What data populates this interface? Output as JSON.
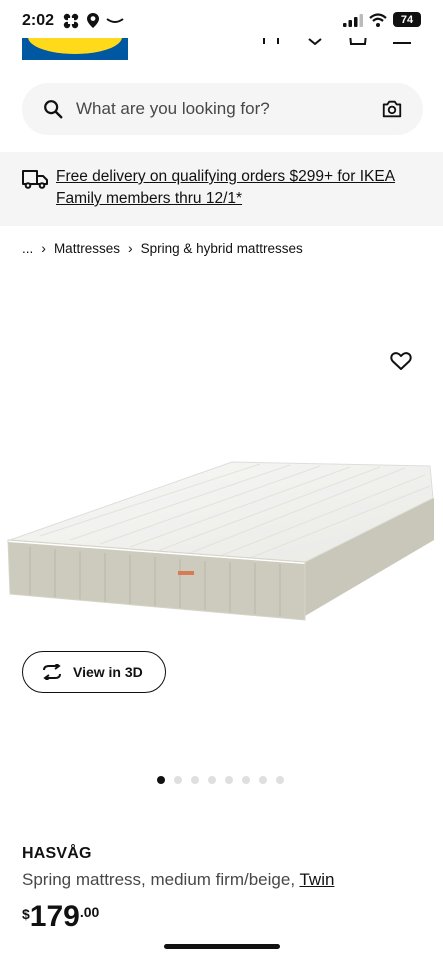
{
  "status_bar": {
    "time": "2:02",
    "battery": "74"
  },
  "search": {
    "placeholder": "What are you looking for?"
  },
  "promo": {
    "text": "Free delivery on qualifying orders $299+ for IKEA Family members thru 12/1*"
  },
  "breadcrumb": {
    "ellipsis": "...",
    "items": [
      "Mattresses",
      "Spring & hybrid mattresses"
    ]
  },
  "view3d": {
    "label": "View in 3D"
  },
  "gallery": {
    "dots": 8,
    "active_index": 0
  },
  "product": {
    "name": "HASVÅG",
    "description": "Spring mattress, medium firm/beige, ",
    "size": "Twin",
    "price": {
      "currency": "$",
      "integer": "179",
      "decimal": ".00"
    }
  },
  "colors": {
    "brand_blue": "#0058a3",
    "brand_yellow": "#ffda1a",
    "text": "#111111",
    "muted": "#484848",
    "surface": "#f5f5f5"
  }
}
